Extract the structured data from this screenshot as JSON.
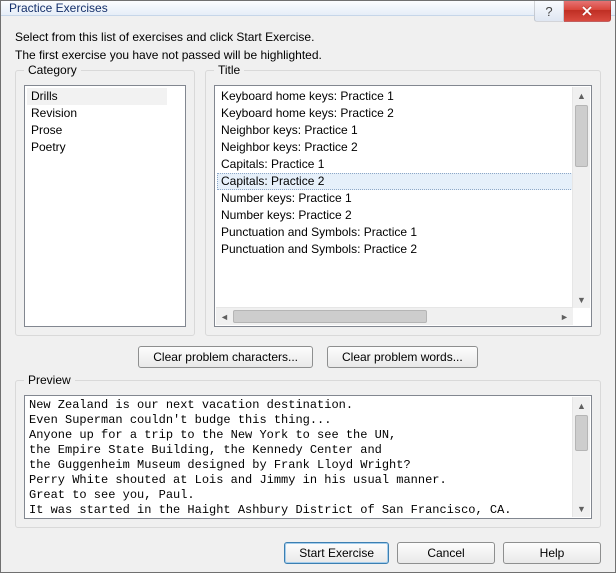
{
  "window": {
    "title": "Practice Exercises",
    "help_glyph": "?",
    "close_aria": "Close"
  },
  "intro": {
    "line1": "Select from this list of exercises and click Start Exercise.",
    "line2": "The first exercise you have not passed will be highlighted."
  },
  "groups": {
    "category_label": "Category",
    "title_label": "Title",
    "preview_label": "Preview"
  },
  "categories": {
    "items": [
      "Drills",
      "Revision",
      "Prose",
      "Poetry"
    ],
    "selected_index": 0
  },
  "titles": {
    "items": [
      "Keyboard home keys: Practice 1",
      "Keyboard home keys: Practice 2",
      "Neighbor keys: Practice 1",
      "Neighbor keys: Practice 2",
      "Capitals: Practice 1",
      "Capitals: Practice 2",
      "Number keys: Practice 1",
      "Number keys: Practice 2",
      "Punctuation and Symbols: Practice 1",
      "Punctuation and Symbols: Practice 2"
    ],
    "highlighted_index": 5
  },
  "buttons": {
    "clear_chars": "Clear problem characters...",
    "clear_words": "Clear problem words...",
    "start": "Start Exercise",
    "cancel": "Cancel",
    "help": "Help"
  },
  "preview_text": "New Zealand is our next vacation destination.\nEven Superman couldn't budge this thing...\nAnyone up for a trip to the New York to see the UN,\nthe Empire State Building, the Kennedy Center and\nthe Guggenheim Museum designed by Frank Lloyd Wright?\nPerry White shouted at Lois and Jimmy in his usual manner.\nGreat to see you, Paul.\nIt was started in the Haight Ashbury District of San Francisco, CA."
}
